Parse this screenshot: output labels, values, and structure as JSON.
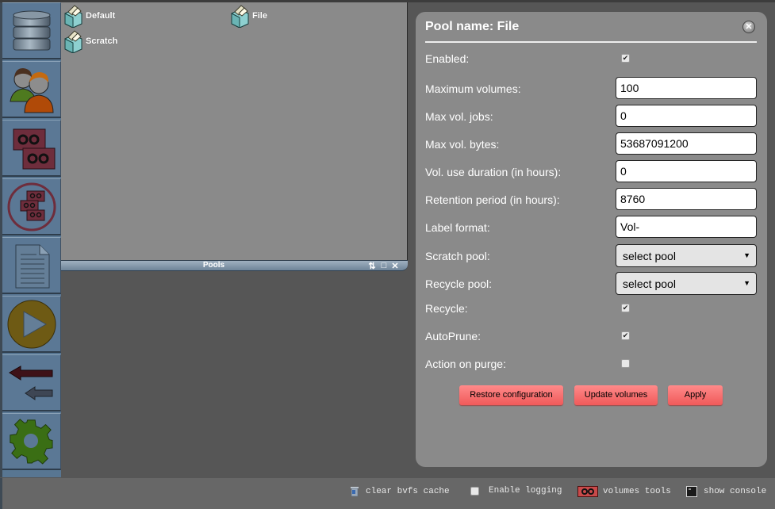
{
  "sidebar": {
    "items": [
      {
        "name": "storage",
        "icon": "database-icon"
      },
      {
        "name": "clients",
        "icon": "users-icon"
      },
      {
        "name": "volumes",
        "icon": "tapes-icon"
      },
      {
        "name": "pools",
        "icon": "pool-tapes-icon"
      },
      {
        "name": "jobs",
        "icon": "document-icon"
      },
      {
        "name": "run-job",
        "icon": "play-icon"
      },
      {
        "name": "restore",
        "icon": "arrows-left-icon"
      },
      {
        "name": "settings",
        "icon": "gear-icon"
      }
    ]
  },
  "pools_window": {
    "title": "Pools",
    "items": [
      {
        "label": "Default"
      },
      {
        "label": "File"
      },
      {
        "label": "Scratch"
      }
    ],
    "controls": {
      "sort": "⇅",
      "maximize": "□",
      "close": "✕"
    }
  },
  "dialog": {
    "title": "Pool name: File",
    "fields": {
      "enabled": {
        "label": "Enabled:",
        "checked": true
      },
      "max_volumes": {
        "label": "Maximum volumes:",
        "value": "100"
      },
      "max_vol_jobs": {
        "label": "Max vol. jobs:",
        "value": "0"
      },
      "max_vol_bytes": {
        "label": "Max vol. bytes:",
        "value": "53687091200"
      },
      "vol_use_duration": {
        "label": "Vol. use duration (in hours):",
        "value": "0"
      },
      "retention_period": {
        "label": "Retention period (in hours):",
        "value": "8760"
      },
      "label_format": {
        "label": "Label format:",
        "value": "Vol-"
      },
      "scratch_pool": {
        "label": "Scratch pool:",
        "value": "select pool"
      },
      "recycle_pool": {
        "label": "Recycle pool:",
        "value": "select pool"
      },
      "recycle": {
        "label": "Recycle:",
        "checked": true
      },
      "autoprune": {
        "label": "AutoPrune:",
        "checked": true
      },
      "action_on_purge": {
        "label": "Action on purge:",
        "checked": false
      }
    },
    "buttons": {
      "restore": "Restore configuration",
      "update": "Update volumes",
      "apply": "Apply"
    },
    "check_glyph": "✔",
    "select_arrow": "▼",
    "close_glyph": "✕"
  },
  "statusbar": {
    "clear_cache": "clear bvfs cache",
    "enable_logging": "Enable logging",
    "enable_logging_checked": false,
    "volumes_tools": "volumes tools",
    "show_console": "show console"
  },
  "colors": {
    "button_red": "#f05a5a",
    "sidebar_blue": "#5b7895",
    "panel_gray": "#8a8a8a"
  }
}
